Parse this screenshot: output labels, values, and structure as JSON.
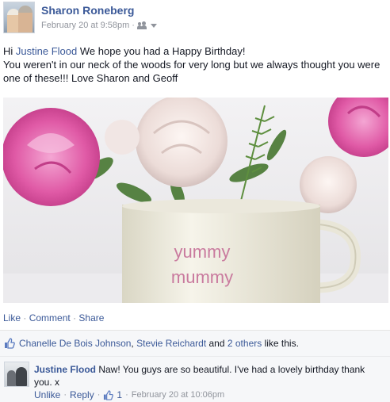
{
  "post": {
    "author": "Sharon Roneberg",
    "timestamp": "February 20 at 9:58pm",
    "separator": "·",
    "audience_icon": "friends-icon",
    "message": {
      "greeting": "Hi",
      "mention": "Justine Flood",
      "line1_rest": "We hope you had a Happy Birthday!",
      "line2": "You weren't in our neck of the woods for very long but we always thought you were one of these!!! Love Sharon and Geoff"
    },
    "photo": {
      "mug_text_line1": "yummy",
      "mug_text_line2": "mummy"
    },
    "actions": {
      "like": "Like",
      "comment": "Comment",
      "share": "Share",
      "separator": "·"
    },
    "likes": {
      "name1": "Chanelle De Bois Johnson",
      "comma": ",",
      "name2": "Stevie Reichardt",
      "and_text": "and",
      "others": "2 others",
      "suffix": "like this."
    },
    "comment": {
      "author": "Justine Flood",
      "text": "Naw! You guys are so beautiful. I've had a lovely birthday thank you. x",
      "unlike": "Unlike",
      "reply": "Reply",
      "like_count": "1",
      "timestamp": "February 20 at 10:06pm",
      "separator": "·"
    }
  },
  "colors": {
    "link": "#3b5998",
    "meta": "#90949c",
    "panel_bg": "#f6f7f9"
  }
}
